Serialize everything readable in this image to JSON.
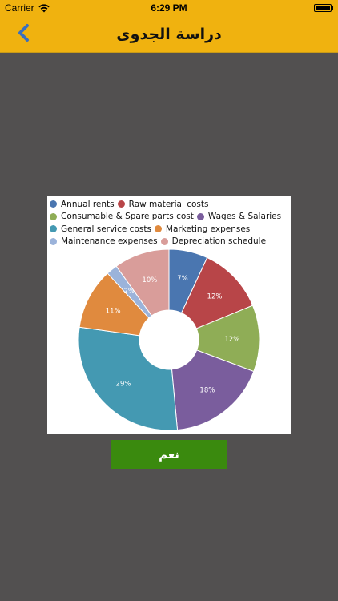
{
  "status_bar": {
    "carrier": "Carrier",
    "time": "6:29 PM",
    "battery_level": 1.0
  },
  "nav": {
    "title": "دراسة الجدوى",
    "back_icon": "chevron-left-icon"
  },
  "colors": {
    "nav_background": "#f0b20f",
    "page_background": "#525050",
    "button_background": "#3a8a0e",
    "back_icon": "#3b6fbf"
  },
  "chart_data": {
    "type": "pie",
    "donut": true,
    "legend_position": "top",
    "slices": [
      {
        "name": "Annual rents",
        "value": 7,
        "label": "7%",
        "color": "#4a76b0"
      },
      {
        "name": "Raw material costs",
        "value": 12,
        "label": "12%",
        "color": "#b84548"
      },
      {
        "name": "Consumable & Spare parts cost",
        "value": 12,
        "label": "12%",
        "color": "#8fad56"
      },
      {
        "name": "Wages & Salaries",
        "value": 18,
        "label": "18%",
        "color": "#7a5d9d"
      },
      {
        "name": "General service costs",
        "value": 29,
        "label": "29%",
        "color": "#4499b2"
      },
      {
        "name": "Marketing expenses",
        "value": 11,
        "label": "11%",
        "color": "#e08a3e"
      },
      {
        "name": "Maintenance expenses",
        "value": 2,
        "label": "2%",
        "color": "#9bb3da"
      },
      {
        "name": "Depreciation schedule",
        "value": 10,
        "label": "10%",
        "color": "#d99d9a"
      }
    ]
  },
  "actions": {
    "yes_label": "نعم"
  }
}
